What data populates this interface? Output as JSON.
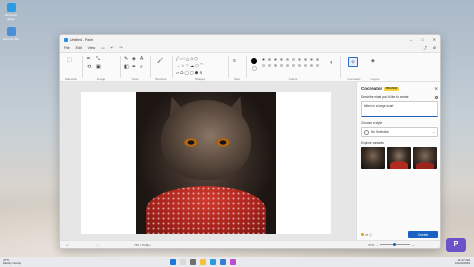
{
  "window": {
    "title": "Untitled - Paint"
  },
  "desktop_icons": [
    {
      "label": "Microsoft Edge",
      "icon": "edge-icon",
      "color": "#2a9be0"
    },
    {
      "label": "Recycle Bin",
      "icon": "recycle-bin-icon",
      "color": "#4a8fd8"
    }
  ],
  "menu": [
    "File",
    "Edit",
    "View"
  ],
  "ribbon": {
    "groups": [
      "Selection",
      "Image",
      "Tools",
      "Brushes",
      "Shapes",
      "Size",
      "Colors",
      "Cocreator",
      "Layers"
    ]
  },
  "panel": {
    "title": "Cocreator",
    "badge": "PREVIEW",
    "describe_label": "Describe what you'd like to create",
    "prompt_value": "kitten in a large scarf",
    "style_label": "Choose a style",
    "style_value": "No Selection",
    "variants_label": "Explore variants",
    "credits": "47",
    "create_label": "Create"
  },
  "statusbar": {
    "size": "725 × 518px",
    "zoom": "87%"
  },
  "taskbar": {
    "weather_temp": "47°F",
    "weather_desc": "Mostly cloudy",
    "time": "11:47 AM",
    "date": "10/24/2023"
  },
  "watermark": "P"
}
